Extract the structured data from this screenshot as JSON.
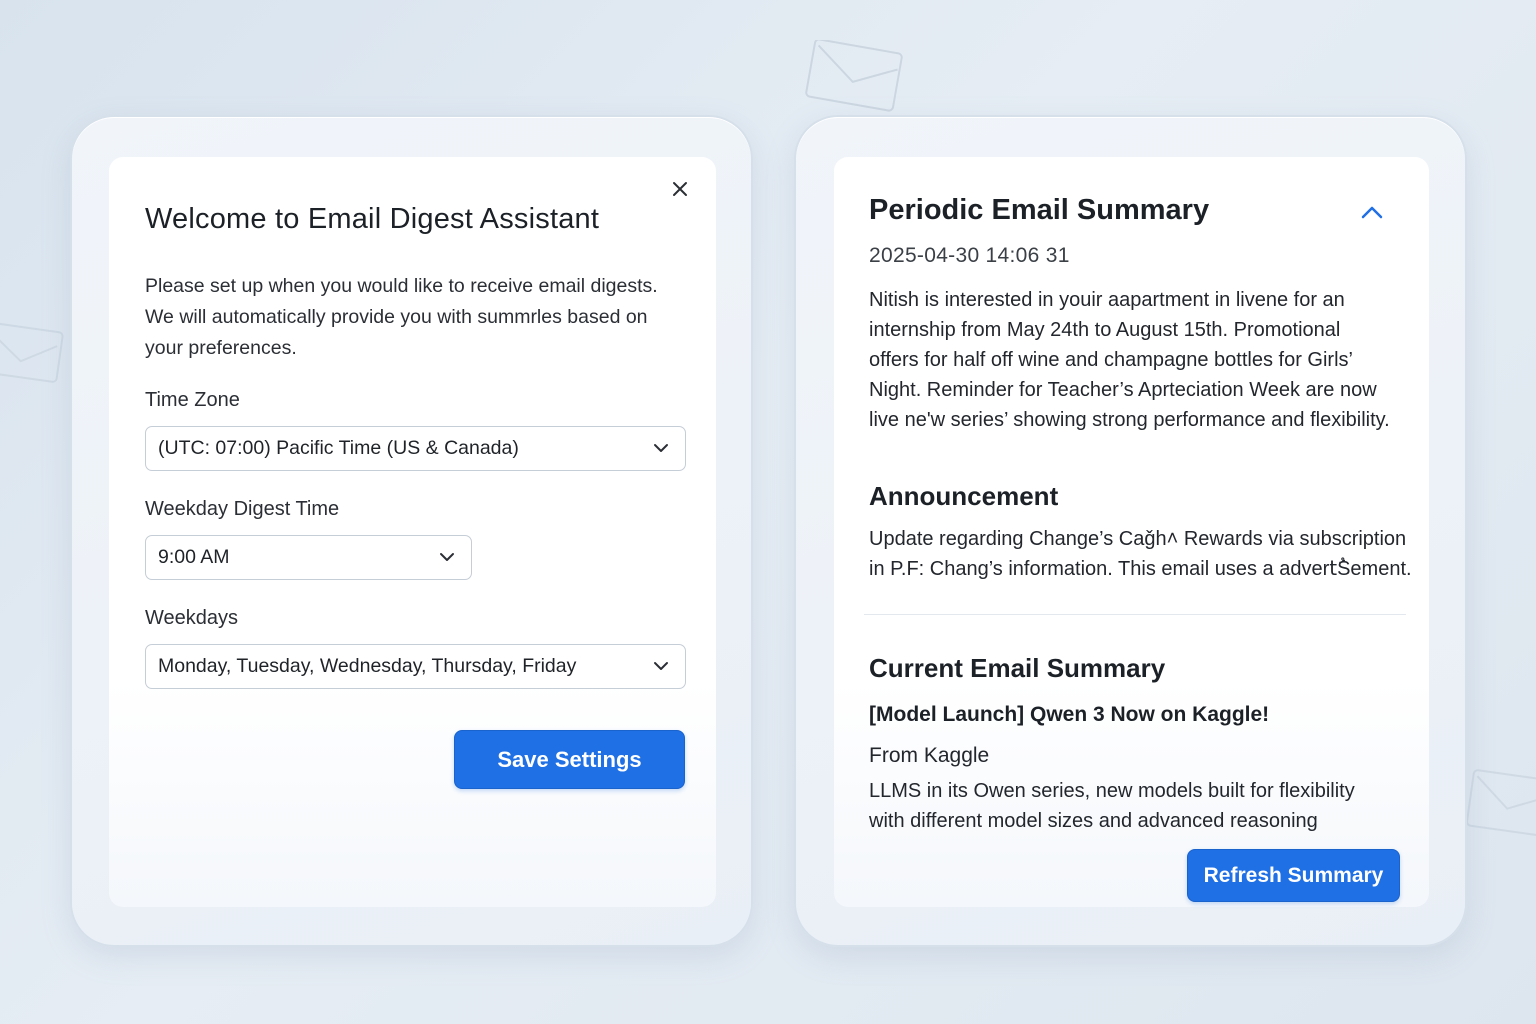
{
  "settings_dialog": {
    "title": "Welcome to Email Digest Assistant",
    "intro": "Please set up when you would like to receive email digests. We will automatically provide you with summrles based on your preferences.",
    "close_icon": "close-icon",
    "time_zone": {
      "label": "Time Zone",
      "value": "(UTC: 07:00) Pacific Time (US & Canada)"
    },
    "digest_time": {
      "label": "Weekday Digest Time",
      "value": "9:00 AM"
    },
    "weekdays": {
      "label": "Weekdays",
      "value": "Monday, Tuesday, Wednesday, Thursday, Friday"
    },
    "save_label": "Save Settings"
  },
  "summary_panel": {
    "periodic": {
      "title": "Periodic Email Summary",
      "collapse_icon": "chevron-up-icon",
      "timestamp": "2025-04-30 14:06 31",
      "body": "Nitish is interested in youir  aapartment in livene for an internship from May 24th to August 15th. Promotional offers for half off wine and champagne bottles for Girls’ Night. Reminder for Teacher’s Aprteciation Week are now live ne'w series’ showing strong performance and flexibility."
    },
    "announcement": {
      "title": "Announcement",
      "body": "Update regarding Change’s Caǧh˄ Rewards via subscription in P.F: Chang’s information. This email uses a advertُSement."
    },
    "current": {
      "title": "Current Email Summary",
      "subject": "[Model Launch] Qwen 3 Now on Kaggle!",
      "from": "From Kaggle",
      "body": "LLMS in its Owen series, new models built for flexibility with different model sizes and advanced reasoning"
    },
    "refresh_label": "Refresh Summary"
  },
  "colors": {
    "accent": "#1f6fe5",
    "background": "#dfe7f0",
    "card": "#ffffff",
    "border": "#c5cdd6"
  }
}
